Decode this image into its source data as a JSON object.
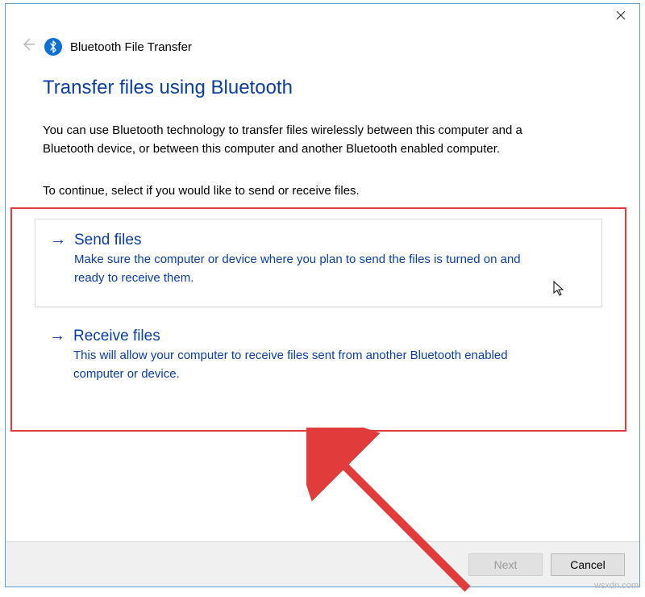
{
  "window": {
    "app_title": "Bluetooth File Transfer"
  },
  "page": {
    "heading": "Transfer files using Bluetooth",
    "intro": "You can use Bluetooth technology to transfer files wirelessly between this computer and a Bluetooth device, or between this computer and another Bluetooth enabled computer.",
    "continue_prompt": "To continue, select if you would like to send or receive files."
  },
  "options": {
    "send": {
      "title": "Send files",
      "desc": "Make sure the computer or device where you plan to send the files is turned on and ready to receive them."
    },
    "receive": {
      "title": "Receive files",
      "desc": "This will allow your computer to receive files sent from another Bluetooth enabled computer or device."
    }
  },
  "footer": {
    "next_label": "Next",
    "cancel_label": "Cancel"
  },
  "watermark": "wsxdn.com"
}
